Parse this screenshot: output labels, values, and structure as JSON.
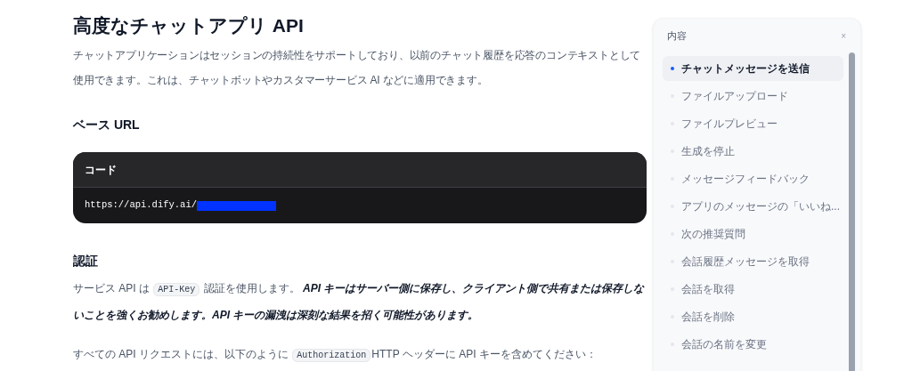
{
  "article": {
    "title": "高度なチャットアプリ API",
    "intro": "チャットアプリケーションはセッションの持続性をサポートしており、以前のチャット履歴を応答のコンテキストとして使用できます。これは、チャットボットやカスタマーサービス AI などに適用できます。",
    "base_url": {
      "heading": "ベース URL",
      "code_label": "コード",
      "url": "https://api.dify.ai/",
      "redacted": true
    },
    "auth": {
      "heading": "認証",
      "paragraphs": [
        [
          {
            "kind": "text",
            "text": "サービス API は "
          },
          {
            "kind": "code",
            "text": "API-Key"
          },
          {
            "kind": "text",
            "text": " 認証を使用します。 "
          },
          {
            "kind": "emphasis",
            "text": "API キーはサーバー側に保存し、クライアント側で共有または保存しないことを強くお勧めします。API キーの漏洩は深刻な結果を招く可能性があります。"
          }
        ],
        [
          {
            "kind": "text",
            "text": "すべての API リクエストには、以下のように "
          },
          {
            "kind": "code",
            "text": "Authorization"
          },
          {
            "kind": "text",
            "text": "HTTP ヘッダーに API キーを含めてください："
          }
        ]
      ]
    }
  },
  "toc": {
    "title": "内容",
    "close": "×",
    "items": [
      {
        "label": "チャットメッセージを送信",
        "selected": true
      },
      {
        "label": "ファイルアップロード",
        "selected": false
      },
      {
        "label": "ファイルプレビュー",
        "selected": false
      },
      {
        "label": "生成を停止",
        "selected": false
      },
      {
        "label": "メッセージフィードバック",
        "selected": false
      },
      {
        "label": "アプリのメッセージの「いいね...",
        "selected": false
      },
      {
        "label": "次の推奨質問",
        "selected": false
      },
      {
        "label": "会話履歴メッセージを取得",
        "selected": false
      },
      {
        "label": "会話を取得",
        "selected": false
      },
      {
        "label": "会話を削除",
        "selected": false
      },
      {
        "label": "会話の名前を変更",
        "selected": false
      }
    ]
  }
}
